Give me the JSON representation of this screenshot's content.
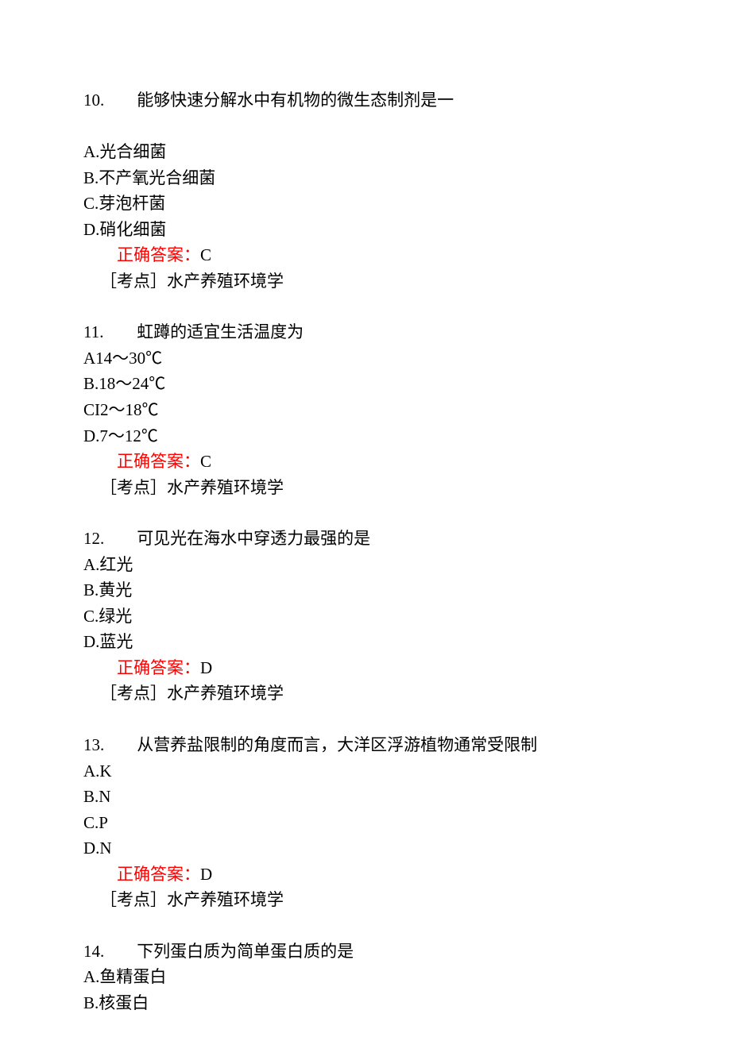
{
  "answer_label": "正确答案：",
  "topic_label": "［考点］",
  "questions": [
    {
      "number": "10.",
      "stem": "能够快速分解水中有机物的微生态制剂是一",
      "options": [
        "A.光合细菌",
        "B.不产氧光合细菌",
        "C.芽泡杆菌",
        "D.硝化细菌"
      ],
      "answer": "C",
      "topic": "水产养殖环境学",
      "gap_after_stem": true
    },
    {
      "number": "11.",
      "stem": "虹蹲的适宜生活温度为",
      "options": [
        "A14～30℃",
        "B.18～24℃",
        "CI2～18℃",
        "D.7～12℃"
      ],
      "answer": "C",
      "topic": "水产养殖环境学",
      "gap_after_stem": false
    },
    {
      "number": "12.",
      "stem": "可见光在海水中穿透力最强的是",
      "options": [
        "A.红光",
        "B.黄光",
        "C.绿光",
        "D.蓝光"
      ],
      "answer": "D",
      "topic": "水产养殖环境学",
      "gap_after_stem": false
    },
    {
      "number": "13.",
      "stem": "从营养盐限制的角度而言，大洋区浮游植物通常受限制",
      "options": [
        "A.K",
        "B.N",
        "C.P",
        "D.N"
      ],
      "answer": "D",
      "topic": "水产养殖环境学",
      "gap_after_stem": false
    },
    {
      "number": "14.",
      "stem": "下列蛋白质为简单蛋白质的是",
      "options": [
        "A.鱼精蛋白",
        "B.核蛋白"
      ],
      "answer": null,
      "topic": null,
      "gap_after_stem": false
    }
  ]
}
